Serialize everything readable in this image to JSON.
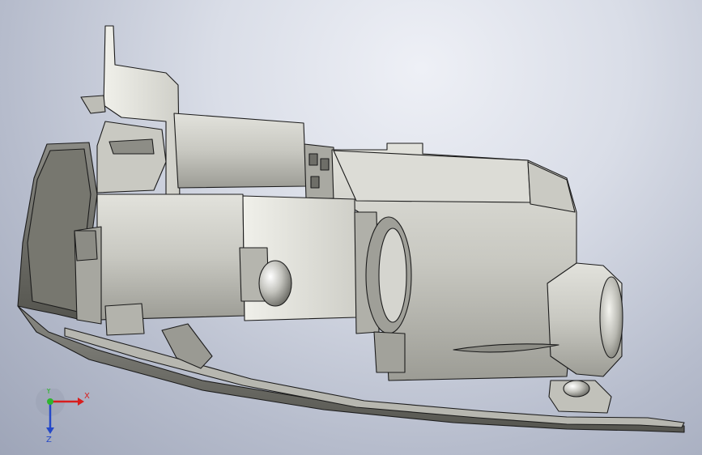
{
  "viewport": {
    "background_top": "#eef0f6",
    "background_bottom": "#9ea5b8"
  },
  "model": {
    "description_icon": "headlamp-assembly-icon",
    "shading_color": "#c9c9c3",
    "edge_color": "#1c1c1c"
  },
  "triad": {
    "x_label": "X",
    "y_label": "Y",
    "z_label": "Z",
    "x_color": "#d81e1e",
    "y_color": "#2fb52f",
    "z_color": "#2448c8"
  }
}
